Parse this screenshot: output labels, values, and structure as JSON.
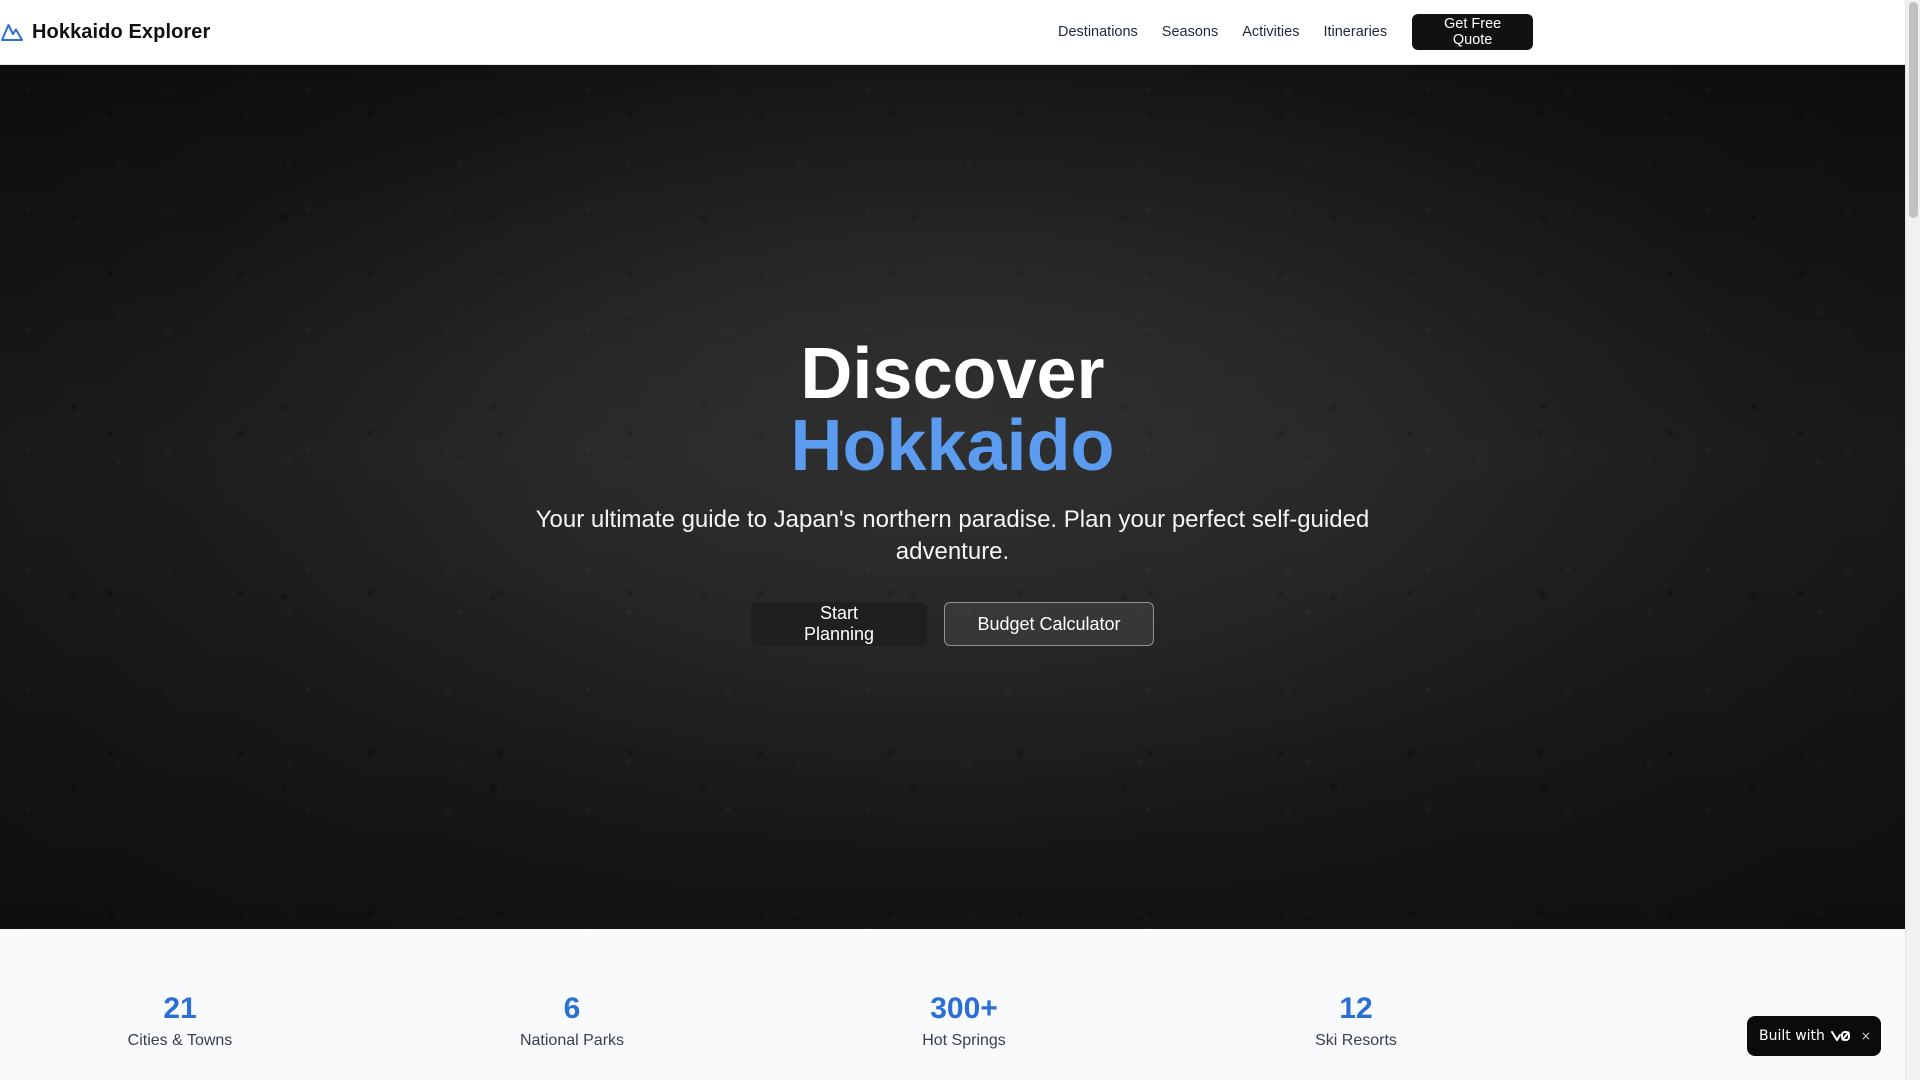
{
  "brand": {
    "name": "Hokkaido Explorer",
    "icon": "mountain-icon",
    "accent": "#2b6fd6"
  },
  "nav": {
    "links": [
      "Destinations",
      "Seasons",
      "Activities",
      "Itineraries"
    ],
    "cta": "Get Free Quote"
  },
  "hero": {
    "title_line1": "Discover",
    "title_line2": "Hokkaido",
    "title_accent": "#5b9cf0",
    "subtitle": "Your ultimate guide to Japan's northern paradise. Plan your perfect self-guided adventure.",
    "primary_button": "Start Planning",
    "secondary_button": "Budget Calculator"
  },
  "stats": [
    {
      "value": "21",
      "label": "Cities & Towns"
    },
    {
      "value": "6",
      "label": "National Parks"
    },
    {
      "value": "300+",
      "label": "Hot Springs"
    },
    {
      "value": "12",
      "label": "Ski Resorts"
    }
  ],
  "badge": {
    "text": "Built with",
    "logo": "v0-logo-icon",
    "close": "×"
  }
}
